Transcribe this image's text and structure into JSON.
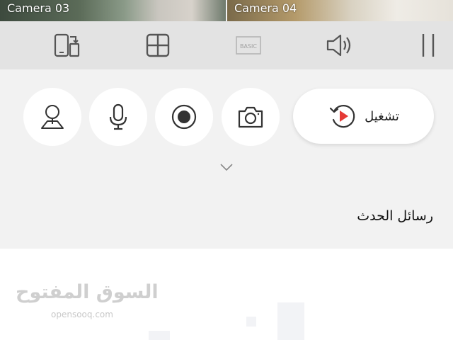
{
  "cameras": [
    {
      "label": "Camera 03"
    },
    {
      "label": "Camera 04"
    }
  ],
  "toolbar": {
    "switch_icon": "phone-switch-icon",
    "grid_icon": "grid-icon",
    "basic_label": "BASIC",
    "volume_icon": "speaker-icon",
    "pause_icon": "pause-icon"
  },
  "controls": {
    "ptz_icon": "ptz-person-icon",
    "mic_icon": "microphone-icon",
    "record_icon": "record-icon",
    "snapshot_icon": "camera-icon",
    "playback_label": "تشغيل",
    "playback_icon": "playback-icon",
    "playback_accent": "#e53935"
  },
  "expand_icon": "chevron-down-icon",
  "events": {
    "title": "رسائل الحدث"
  },
  "watermark": {
    "arabic": "السوق المفتوح",
    "english": "opensooq.com"
  }
}
